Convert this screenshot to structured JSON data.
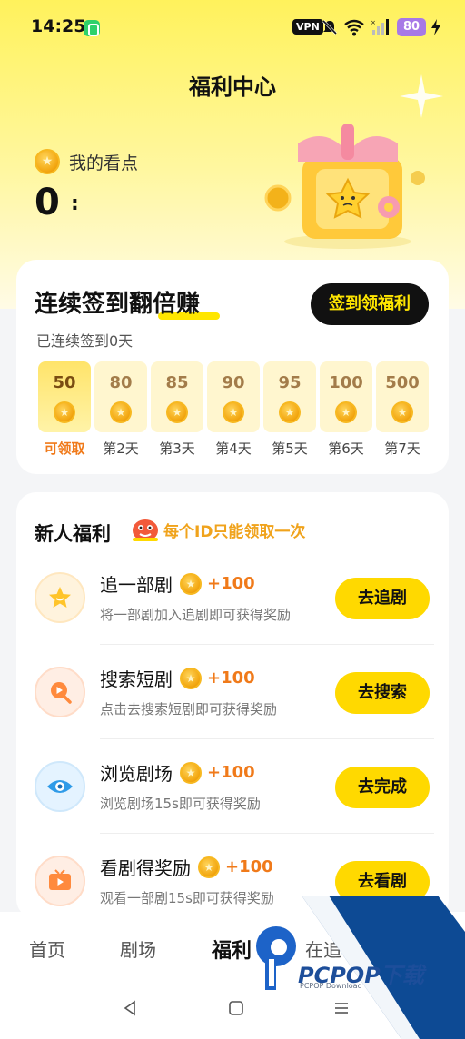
{
  "status_bar": {
    "time": "14:25",
    "vpn": "VPN",
    "battery": "80",
    "icons": [
      "app-icon",
      "vpn-icon",
      "mute-icon",
      "wifi-icon",
      "signal-icon",
      "battery-icon",
      "charging-icon"
    ]
  },
  "header": {
    "title": "福利中心"
  },
  "points": {
    "label": "我的看点",
    "value": "0",
    "arrow": ":"
  },
  "sign_in": {
    "title": "连续签到翻倍赚",
    "button": "签到领福利",
    "streak": "已连续签到0天",
    "days": [
      {
        "value": "50",
        "label": "可领取",
        "active": true
      },
      {
        "value": "80",
        "label": "第2天"
      },
      {
        "value": "85",
        "label": "第3天"
      },
      {
        "value": "90",
        "label": "第4天"
      },
      {
        "value": "95",
        "label": "第5天"
      },
      {
        "value": "100",
        "label": "第6天"
      },
      {
        "value": "500",
        "label": "第7天"
      }
    ]
  },
  "newbie": {
    "title": "新人福利",
    "note": "每个ID只能领取一次",
    "tasks": [
      {
        "name": "追一部剧",
        "reward": "+100",
        "desc": "将一部剧加入追剧即可获得奖励",
        "button": "去追剧",
        "icon": "star-icon"
      },
      {
        "name": "搜索短剧",
        "reward": "+100",
        "desc": "点击去搜索短剧即可获得奖励",
        "button": "去搜索",
        "icon": "search-play-icon"
      },
      {
        "name": "浏览剧场",
        "reward": "+100",
        "desc": "浏览剧场15s即可获得奖励",
        "button": "去完成",
        "icon": "eye-icon"
      },
      {
        "name": "看剧得奖励",
        "reward": "+100",
        "desc": "观看一部剧15s即可获得奖励",
        "button": "去看剧",
        "icon": "tv-play-icon"
      }
    ]
  },
  "bottom_nav": {
    "tabs": [
      "首页",
      "剧场",
      "福利",
      "在追"
    ],
    "active": "福利"
  },
  "watermark": {
    "brand": "PCPOP下载",
    "sub": "PCPOP Download"
  },
  "colors": {
    "accent_yellow": "#ffd900",
    "reward_orange": "#f07a1a",
    "dark": "#111111"
  }
}
